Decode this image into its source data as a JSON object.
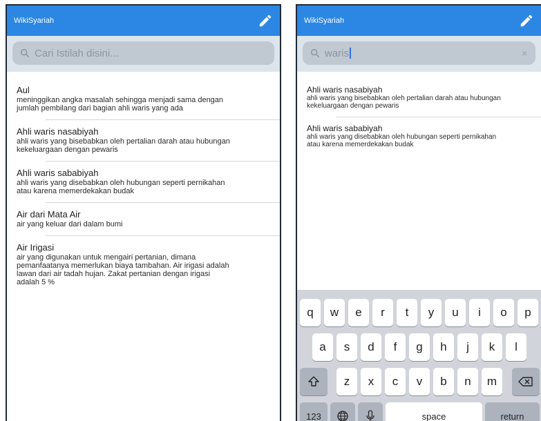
{
  "left": {
    "appbar": {
      "title": "WikiSyariah"
    },
    "search": {
      "placeholder": "Cari Istilah disini..."
    },
    "items": [
      {
        "title": "Aul",
        "desc": [
          "meninggikan angka masalah sehingga menjadi sama dengan",
          "jumlah pembilang dari bagian ahli waris yang ada"
        ]
      },
      {
        "title": "Ahli waris nasabiyah",
        "desc": [
          "ahli waris yang bisebabkan oleh pertalian darah atau hubungan",
          "kekeluargaan dengan pewaris"
        ]
      },
      {
        "title": "Ahli waris sababiyah",
        "desc": [
          "ahli waris yang disebabkan oleh hubungan seperti pernikahan",
          "atau karena memerdekakan budak"
        ]
      },
      {
        "title": "Air dari Mata Air",
        "desc": [
          "air yang keluar dari dalam bumi"
        ]
      },
      {
        "title": "Air Irigasi",
        "desc": [
          "air yang digunakan untuk mengairi pertanian, dimana",
          "pemanfaatanya memerlukan biaya tambahan. Air irigasi adalah",
          "lawan dari air tadah hujan. Zakat pertanian dengan irigasi",
          "adalah 5 %"
        ]
      }
    ]
  },
  "right": {
    "appbar": {
      "title": "WikiSyariah"
    },
    "search": {
      "value": "waris",
      "clear": "×"
    },
    "items": [
      {
        "title": "Ahli waris nasabiyah",
        "desc": [
          "ahli waris yang bisebabkan oleh pertalian darah atau hubungan",
          "kekeluargaan dengan pewaris"
        ]
      },
      {
        "title": "Ahli waris sababiyah",
        "desc": [
          "ahli waris yang disebabkan oleh hubungan seperti pernikahan",
          "atau karena memerdekakan budak"
        ]
      }
    ]
  },
  "keyboard": {
    "row1": [
      "q",
      "w",
      "e",
      "r",
      "t",
      "y",
      "u",
      "i",
      "o",
      "p"
    ],
    "row2": [
      "a",
      "s",
      "d",
      "f",
      "g",
      "h",
      "j",
      "k",
      "l"
    ],
    "row3": [
      "z",
      "x",
      "c",
      "v",
      "b",
      "n",
      "m"
    ],
    "numbers_label": "123",
    "space_label": "space",
    "return_label": "return"
  },
  "colors": {
    "appbar": "#2b87e3",
    "searchbg": "#dde5ec",
    "keyboard": "#d1d4da"
  }
}
